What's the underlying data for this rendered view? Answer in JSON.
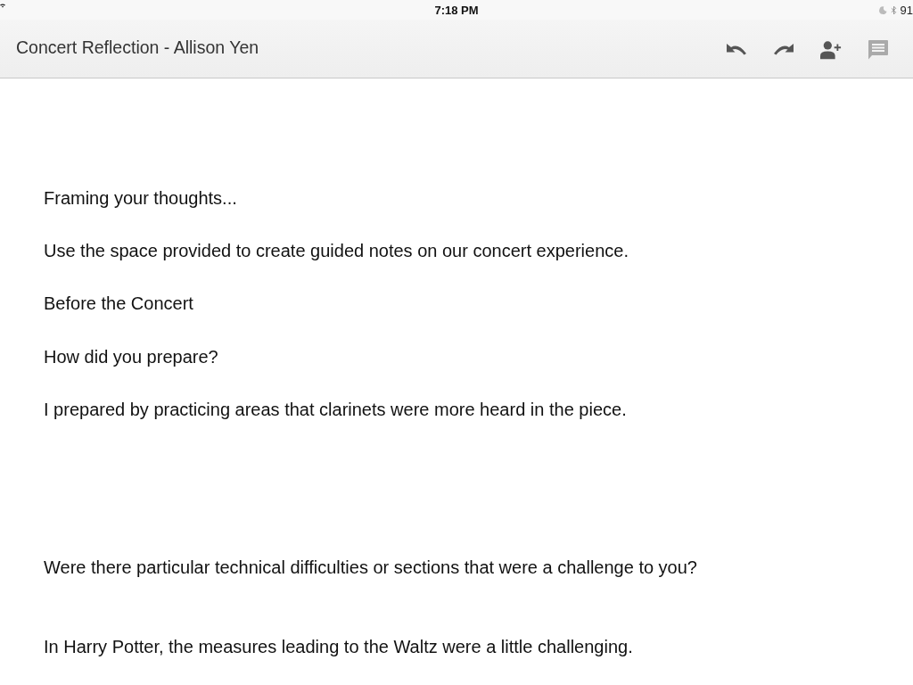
{
  "status_bar": {
    "time": "7:18 PM",
    "battery_text": "91"
  },
  "toolbar": {
    "title": "Concert Reflection - Allison Yen",
    "buttons": [
      {
        "kind": "undo",
        "disabled": false
      },
      {
        "kind": "redo",
        "disabled": false
      },
      {
        "kind": "share",
        "disabled": false
      },
      {
        "kind": "comments",
        "disabled": true
      }
    ]
  },
  "document": {
    "paragraphs": [
      "Framing your thoughts...",
      "Use the space provided to create guided notes on our concert experience.",
      "Before the Concert",
      "How did you prepare?",
      "I prepared by practicing areas that clarinets were more heard in the piece.",
      "Were there particular technical difficulties or sections that were a challenge to you?",
      "In Harry Potter, the measures leading to the Waltz were a little challenging."
    ]
  }
}
